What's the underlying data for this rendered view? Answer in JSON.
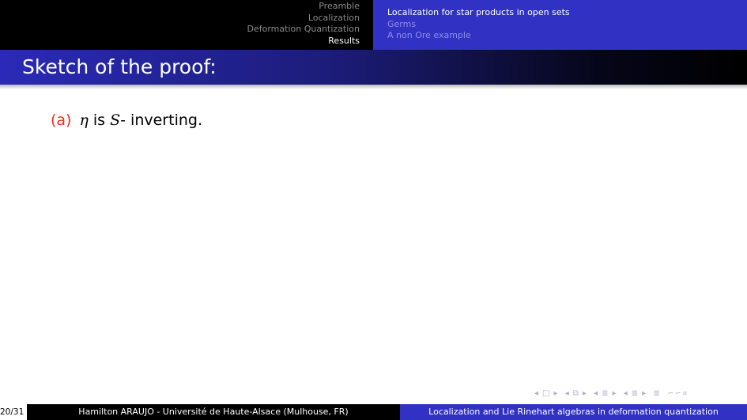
{
  "header": {
    "sections": [
      {
        "label": "Preamble",
        "active": false
      },
      {
        "label": "Localization",
        "active": false
      },
      {
        "label": "Deformation Quantization",
        "active": false
      },
      {
        "label": "Results",
        "active": true
      }
    ],
    "subsections": [
      {
        "label": "Localization for star products in open sets",
        "active": true
      },
      {
        "label": "Germs",
        "active": false
      },
      {
        "label": "A non Ore example",
        "active": false
      }
    ]
  },
  "frame": {
    "title": "Sketch of the proof:"
  },
  "content": {
    "item_label": "(a)",
    "math_eta": "η",
    "text_is": " is ",
    "math_S": "S",
    "text_rest": "- inverting."
  },
  "nav_symbols": {
    "frame_prev": "◂",
    "frame_icon": "□",
    "frame_next": "▸",
    "subsection_prev": "◂",
    "subsection_icon": "⧉",
    "subsection_next": "▸",
    "section_prev": "◂",
    "section_icon": "≣",
    "section_next": "▸",
    "subsubsection_prev": "◂",
    "subsubsection_icon": "≣",
    "subsubsection_next": "▸",
    "doc_icon": "≣",
    "search_icon": "∽∽∝"
  },
  "footer": {
    "page": "20/31",
    "author": "Hamilton ARAUJO - Université de Haute-Alsace (Mulhouse, FR)",
    "title": "Localization and Lie Rinehart algebras in deformation quantization"
  },
  "colors": {
    "header_left_bg": "#000000",
    "header_right_bg": "#3131c4",
    "enum_label": "#e8301a",
    "inactive_section": "#8a8a8a",
    "inactive_subsection": "#8e8eea"
  }
}
